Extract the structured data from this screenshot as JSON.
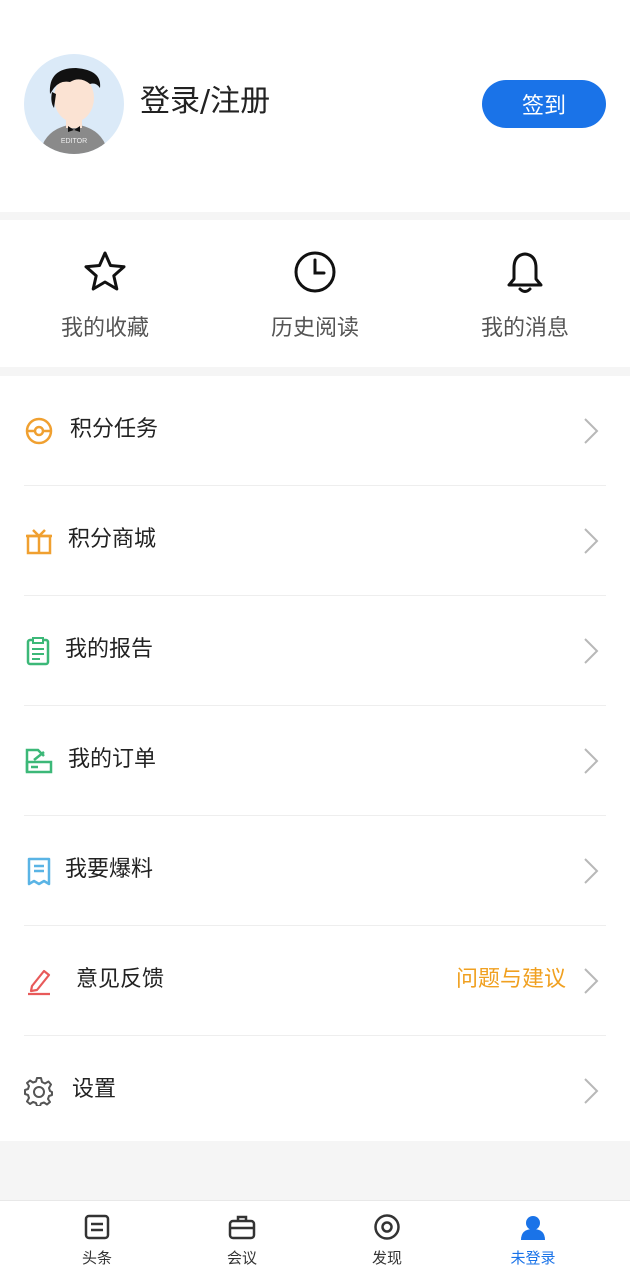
{
  "profile": {
    "login_text": "登录/注册",
    "sign_in_label": "签到",
    "avatar_badge": "EDITOR"
  },
  "quick_actions": [
    {
      "label": "我的收藏",
      "icon": "star-icon"
    },
    {
      "label": "历史阅读",
      "icon": "clock-icon"
    },
    {
      "label": "我的消息",
      "icon": "bell-icon"
    }
  ],
  "menu": [
    {
      "label": "积分任务",
      "icon": "points-task-icon",
      "color": "#f0a030"
    },
    {
      "label": "积分商城",
      "icon": "gift-icon",
      "color": "#f0a030"
    },
    {
      "label": "我的报告",
      "icon": "clipboard-icon",
      "color": "#3cb878"
    },
    {
      "label": "我的订单",
      "icon": "order-icon",
      "color": "#3cb878"
    },
    {
      "label": "我要爆料",
      "icon": "receipt-icon",
      "color": "#5ab4e5"
    },
    {
      "label": "意见反馈",
      "icon": "edit-icon",
      "color": "#e85a5a",
      "extra": "问题与建议"
    },
    {
      "label": "设置",
      "icon": "gear-icon",
      "color": "#555555"
    }
  ],
  "tabbar": [
    {
      "label": "头条",
      "icon": "news-icon"
    },
    {
      "label": "会议",
      "icon": "briefcase-icon"
    },
    {
      "label": "发现",
      "icon": "discover-icon"
    },
    {
      "label": "未登录",
      "icon": "user-icon",
      "active": true
    }
  ],
  "colors": {
    "accent": "#1a73e8",
    "highlight": "#f0a020"
  }
}
